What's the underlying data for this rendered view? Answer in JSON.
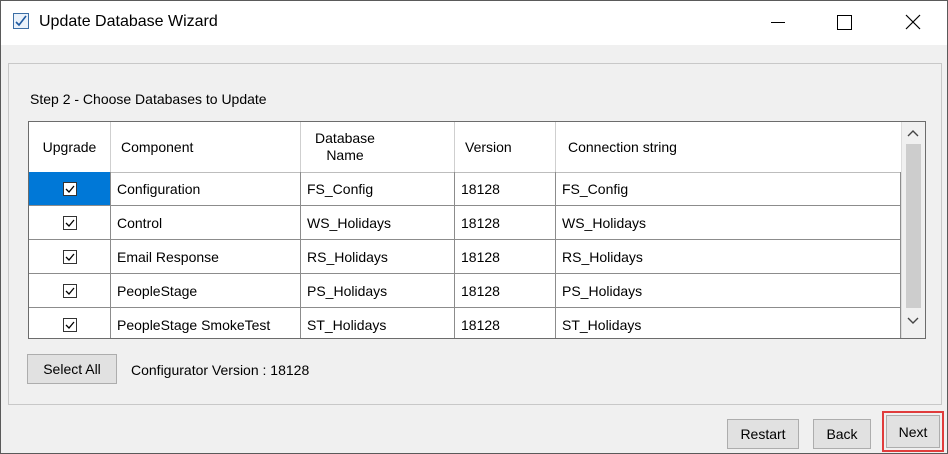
{
  "window": {
    "title": "Update Database Wizard"
  },
  "step": {
    "label": "Step 2 - Choose Databases to Update"
  },
  "table": {
    "columns": [
      "Upgrade",
      "Component",
      "Database Name",
      "Version",
      "Connection string"
    ],
    "rows": [
      {
        "upgrade": true,
        "component": "Configuration",
        "database_name": "FS_Config",
        "version": "18128",
        "connection": "FS_Config"
      },
      {
        "upgrade": true,
        "component": "Control",
        "database_name": "WS_Holidays",
        "version": "18128",
        "connection": "WS_Holidays"
      },
      {
        "upgrade": true,
        "component": "Email Response",
        "database_name": "RS_Holidays",
        "version": "18128",
        "connection": "RS_Holidays"
      },
      {
        "upgrade": true,
        "component": "PeopleStage",
        "database_name": "PS_Holidays",
        "version": "18128",
        "connection": "PS_Holidays"
      },
      {
        "upgrade": true,
        "component": "PeopleStage SmokeTest",
        "database_name": "ST_Holidays",
        "version": "18128",
        "connection": "ST_Holidays"
      }
    ]
  },
  "buttons": {
    "select_all": "Select All",
    "restart": "Restart",
    "back": "Back",
    "next": "Next"
  },
  "configurator_version": "Configurator Version : 18128",
  "colors": {
    "selection": "#0078d7",
    "highlight_outline": "#e03c3c"
  },
  "icons": {
    "app": "wizard-check-icon",
    "minimize": "minimize-icon",
    "maximize": "maximize-icon",
    "close": "close-icon"
  }
}
